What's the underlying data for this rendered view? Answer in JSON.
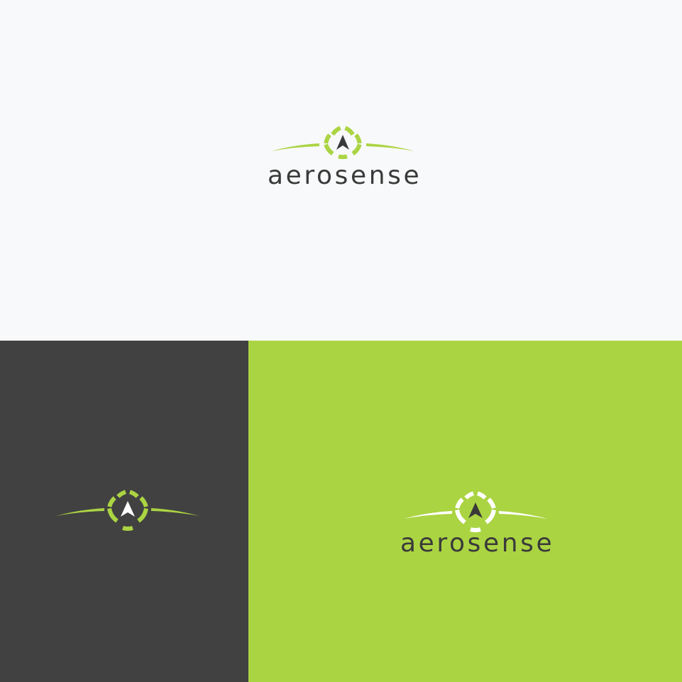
{
  "brand": {
    "wordmark": "aerosense",
    "colors": {
      "light_bg": "#f8f9fa",
      "dark_bg": "#414141",
      "green": "#abd443",
      "ink": "#3a3a3a",
      "white": "#ffffff"
    }
  },
  "variants": [
    {
      "name": "logo-on-light",
      "background": "#f8f9fa",
      "ring_color": "#abd443",
      "wing_color": "#abd443",
      "arrow_color": "#3a3a3a",
      "shows_wordmark": true,
      "wordmark_color": "#3a3a3a"
    },
    {
      "name": "logo-on-dark",
      "background": "#414141",
      "ring_color": "#abd443",
      "wing_color": "#abd443",
      "arrow_color": "#ffffff",
      "shows_wordmark": false
    },
    {
      "name": "logo-on-green",
      "background": "#abd443",
      "ring_color": "#ffffff",
      "wing_color": "#ffffff",
      "arrow_color": "#3a3a3a",
      "shows_wordmark": true,
      "wordmark_color": "#3a3a3a"
    }
  ],
  "icons": {
    "mark": "compass-ring-with-wings",
    "arrow": "navigation-arrow-icon"
  }
}
